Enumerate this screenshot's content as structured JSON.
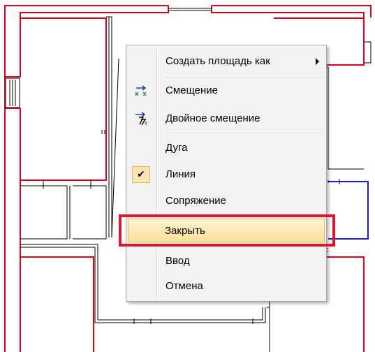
{
  "context_menu": {
    "items": [
      {
        "label": "Создать площадь как",
        "icon": "",
        "has_submenu": true
      },
      {
        "label": "Смещение",
        "icon": "offset-icon"
      },
      {
        "label": "Двойное смещение",
        "icon": "double-offset-icon"
      },
      {
        "label": "Дуга",
        "icon": ""
      },
      {
        "label": "Линия",
        "icon": "checkmark-icon",
        "checked": true,
        "check_glyph": "✔"
      },
      {
        "label": "Сопряжение",
        "icon": ""
      },
      {
        "label": "Закрыть",
        "icon": "",
        "highlighted": true
      },
      {
        "label": "Ввод",
        "icon": ""
      },
      {
        "label": "Отмена",
        "icon": ""
      }
    ]
  },
  "colors": {
    "wall_red": "#e0001b",
    "wall_blue": "#1c1ce6",
    "menu_background": "#f3f3f3",
    "hover_background": "#fbe199",
    "annotation_red": "#e0142a"
  }
}
